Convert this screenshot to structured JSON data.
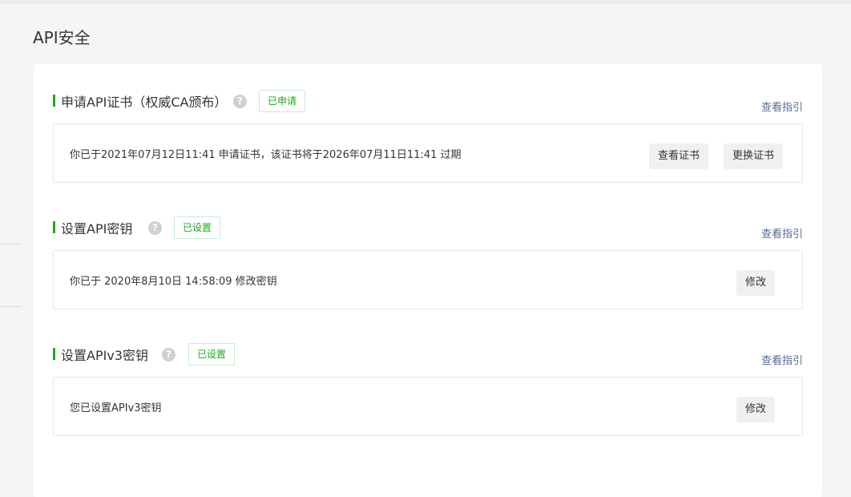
{
  "page": {
    "title": "API安全"
  },
  "sections": [
    {
      "title": "申请API证书（权威CA颁布）",
      "help": "?",
      "status": "已申请",
      "guide": "查看指引",
      "text": "你已于2021年07月12日11:41 申请证书，该证书将于2026年07月11日11:41 过期",
      "buttons": [
        "查看证书",
        "更换证书"
      ]
    },
    {
      "title": "设置API密钥",
      "help": "?",
      "status": "已设置",
      "guide": "查看指引",
      "text": "你已于 2020年8月10日 14:58:09 修改密钥",
      "buttons": [
        "修改"
      ]
    },
    {
      "title": "设置APIv3密钥",
      "help": "?",
      "status": "已设置",
      "guide": "查看指引",
      "text": "您已设置APIv3密钥",
      "buttons": [
        "修改"
      ]
    }
  ],
  "colors": {
    "accent": "#1aad19",
    "link": "#576b95",
    "badge_border": "#c9ecd4"
  }
}
